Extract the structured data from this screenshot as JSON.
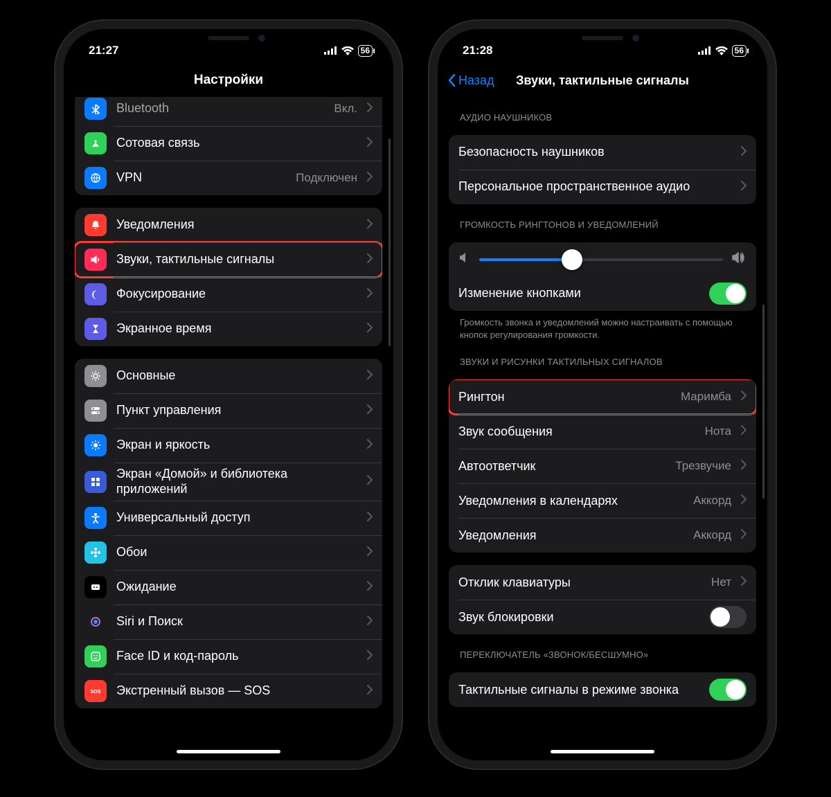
{
  "left": {
    "status": {
      "time": "21:27",
      "battery": "56"
    },
    "title": "Настройки",
    "groups": [
      {
        "items": [
          {
            "label": "Bluetooth",
            "value": "Вкл.",
            "icon": "bluetooth",
            "color": "#0a7aff",
            "cut": true
          },
          {
            "label": "Сотовая связь",
            "value": "",
            "icon": "antenna",
            "color": "#30d158"
          },
          {
            "label": "VPN",
            "value": "Подключен",
            "icon": "vpn",
            "color": "#0a7aff"
          }
        ]
      },
      {
        "items": [
          {
            "label": "Уведомления",
            "value": "",
            "icon": "bell",
            "color": "#ff3b30"
          },
          {
            "label": "Звуки, тактильные сигналы",
            "value": "",
            "icon": "speaker",
            "color": "#ff2d55",
            "highlight": true
          },
          {
            "label": "Фокусирование",
            "value": "",
            "icon": "moon",
            "color": "#5e5ce6"
          },
          {
            "label": "Экранное время",
            "value": "",
            "icon": "hourglass",
            "color": "#5e5ce6"
          }
        ]
      },
      {
        "items": [
          {
            "label": "Основные",
            "value": "",
            "icon": "gear",
            "color": "#8e8e93"
          },
          {
            "label": "Пункт управления",
            "value": "",
            "icon": "switches",
            "color": "#8e8e93"
          },
          {
            "label": "Экран и яркость",
            "value": "",
            "icon": "brightness",
            "color": "#0a7aff"
          },
          {
            "label": "Экран «Домой» и библиотека приложений",
            "value": "",
            "icon": "grid",
            "color": "#3a5bd9"
          },
          {
            "label": "Универсальный доступ",
            "value": "",
            "icon": "accessibility",
            "color": "#0a7aff"
          },
          {
            "label": "Обои",
            "value": "",
            "icon": "flower",
            "color": "#22c3e6"
          },
          {
            "label": "Ожидание",
            "value": "",
            "icon": "standby",
            "color": "#000000"
          },
          {
            "label": "Siri и Поиск",
            "value": "",
            "icon": "siri",
            "color": "#1c1c1e"
          },
          {
            "label": "Face ID и код-пароль",
            "value": "",
            "icon": "faceid",
            "color": "#30d158"
          },
          {
            "label": "Экстренный вызов — SOS",
            "value": "",
            "icon": "sos",
            "color": "#ff3b30"
          }
        ]
      }
    ]
  },
  "right": {
    "status": {
      "time": "21:28",
      "battery": "56"
    },
    "back": "Назад",
    "title": "Звуки, тактильные сигналы",
    "section_audio": "АУДИО НАУШНИКОВ",
    "audio_items": [
      {
        "label": "Безопасность наушников",
        "value": ""
      },
      {
        "label": "Персональное пространственное аудио",
        "value": ""
      }
    ],
    "section_volume": "ГРОМКОСТЬ РИНГТОНОВ И УВЕДОМЛЕНИЙ",
    "slider_value": 38,
    "change_buttons_label": "Изменение кнопками",
    "change_buttons_on": true,
    "volume_footer": "Громкость звонка и уведомлений можно настраивать с помощью кнопок регулирования громкости.",
    "section_sounds": "ЗВУКИ И РИСУНКИ ТАКТИЛЬНЫХ СИГНАЛОВ",
    "sound_items": [
      {
        "label": "Рингтон",
        "value": "Маримба",
        "highlight": true
      },
      {
        "label": "Звук сообщения",
        "value": "Нота"
      },
      {
        "label": "Автоответчик",
        "value": "Трезвучие"
      },
      {
        "label": "Уведомления в календарях",
        "value": "Аккорд"
      },
      {
        "label": "Уведомления",
        "value": "Аккорд"
      }
    ],
    "keyboard_label": "Отклик клавиатуры",
    "keyboard_value": "Нет",
    "lock_label": "Звук блокировки",
    "lock_on": false,
    "section_switch": "ПЕРЕКЛЮЧАТЕЛЬ «ЗВОНОК/БЕСШУМНО»",
    "haptic_ring_label": "Тактильные сигналы в режиме звонка",
    "haptic_ring_on": true
  }
}
